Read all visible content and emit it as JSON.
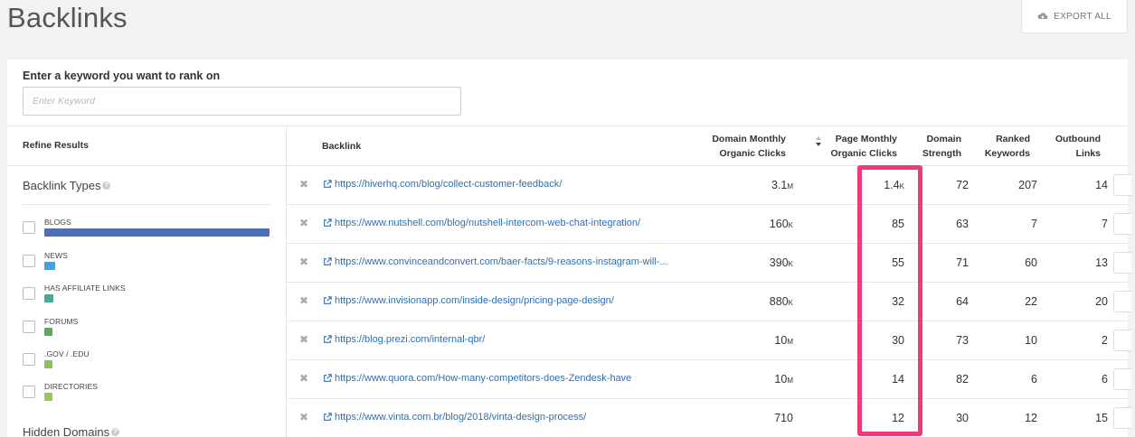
{
  "header": {
    "title": "Backlinks",
    "export_label": "EXPORT ALL"
  },
  "keyword": {
    "label": "Enter a keyword you want to rank on",
    "placeholder": "Enter Keyword",
    "value": ""
  },
  "sidebar": {
    "title": "Refine Results",
    "types_title": "Backlink Types",
    "types": [
      {
        "label": "BLOGS",
        "color": "#4a6fbf",
        "level": 1.0
      },
      {
        "label": "NEWS",
        "color": "#4a9fd8",
        "level": 0.05
      },
      {
        "label": "HAS AFFILIATE LINKS",
        "color": "#4aaa96",
        "level": 0.04
      },
      {
        "label": "FORUMS",
        "color": "#5aaa5a",
        "level": 0.03
      },
      {
        "label": ".GOV / .EDU",
        "color": "#8cc05a",
        "level": 0.03
      },
      {
        "label": "DIRECTORIES",
        "color": "#9cc45a",
        "level": 0.03
      }
    ],
    "hidden_title": "Hidden Domains"
  },
  "table": {
    "columns": {
      "backlink": "Backlink",
      "domain_clicks_1": "Domain Monthly",
      "domain_clicks_2": "Organic Clicks",
      "page_clicks_1": "Page Monthly",
      "page_clicks_2": "Organic Clicks",
      "strength_1": "Domain",
      "strength_2": "Strength",
      "ranked_1": "Ranked",
      "ranked_2": "Keywords",
      "outbound_1": "Outbound",
      "outbound_2": "Links"
    },
    "rows": [
      {
        "url": "https://hiverhq.com/blog/collect-customer-feedback/",
        "domain_clicks": "3.1",
        "domain_unit": "M",
        "page_clicks": "1.4",
        "page_unit": "K",
        "strength": "72",
        "ranked": "207",
        "outbound": "14"
      },
      {
        "url": "https://www.nutshell.com/blog/nutshell-intercom-web-chat-integration/",
        "domain_clicks": "160",
        "domain_unit": "K",
        "page_clicks": "85",
        "page_unit": "",
        "strength": "63",
        "ranked": "7",
        "outbound": "7"
      },
      {
        "url": "https://www.convinceandconvert.com/baer-facts/9-reasons-instagram-will-...",
        "domain_clicks": "390",
        "domain_unit": "K",
        "page_clicks": "55",
        "page_unit": "",
        "strength": "71",
        "ranked": "60",
        "outbound": "13"
      },
      {
        "url": "https://www.invisionapp.com/inside-design/pricing-page-design/",
        "domain_clicks": "880",
        "domain_unit": "K",
        "page_clicks": "32",
        "page_unit": "",
        "strength": "64",
        "ranked": "22",
        "outbound": "20"
      },
      {
        "url": "https://blog.prezi.com/internal-qbr/",
        "domain_clicks": "10",
        "domain_unit": "M",
        "page_clicks": "30",
        "page_unit": "",
        "strength": "73",
        "ranked": "10",
        "outbound": "2"
      },
      {
        "url": "https://www.quora.com/How-many-competitors-does-Zendesk-have",
        "domain_clicks": "10",
        "domain_unit": "M",
        "page_clicks": "14",
        "page_unit": "",
        "strength": "82",
        "ranked": "6",
        "outbound": "6"
      },
      {
        "url": "https://www.vinta.com.br/blog/2018/vinta-design-process/",
        "domain_clicks": "710",
        "domain_unit": "",
        "page_clicks": "12",
        "page_unit": "",
        "strength": "30",
        "ranked": "12",
        "outbound": "15"
      }
    ]
  },
  "colors": {
    "accent_link": "#2f6fb0",
    "highlight": "#ef3b72"
  }
}
